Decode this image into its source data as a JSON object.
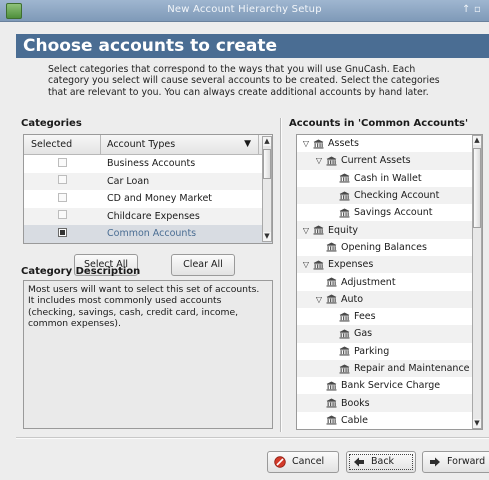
{
  "window": {
    "title": "New Account Hierarchy Setup"
  },
  "header": {
    "title": "Choose accounts to create"
  },
  "intro": {
    "text": "Select categories that correspond to the ways that you will use GnuCash. Each category you select will cause several accounts to be created. Select the categories that are relevant to you. You can always create additional accounts by hand later."
  },
  "categories": {
    "label": "Categories",
    "col_selected": "Selected",
    "col_type": "Account Types",
    "rows": [
      {
        "name": "Business Accounts",
        "checked": false
      },
      {
        "name": "Car Loan",
        "checked": false
      },
      {
        "name": "CD and Money Market",
        "checked": false
      },
      {
        "name": "Childcare Expenses",
        "checked": false
      },
      {
        "name": "Common Accounts",
        "checked": true
      }
    ],
    "select_all": "Select All",
    "clear_all": "Clear All"
  },
  "description": {
    "label": "Category Description",
    "text": "Most users will want to select this set of accounts. It includes most commonly used accounts (checking, savings, cash, credit card, income, common expenses)."
  },
  "accounts": {
    "label": "Accounts in 'Common Accounts'",
    "rows": [
      {
        "name": "Assets",
        "level": 0,
        "expander": "expanded"
      },
      {
        "name": "Current Assets",
        "level": 1,
        "expander": "expanded"
      },
      {
        "name": "Cash in Wallet",
        "level": 2,
        "expander": "none"
      },
      {
        "name": "Checking Account",
        "level": 2,
        "expander": "none"
      },
      {
        "name": "Savings Account",
        "level": 2,
        "expander": "none"
      },
      {
        "name": "Equity",
        "level": 0,
        "expander": "expanded"
      },
      {
        "name": "Opening Balances",
        "level": 1,
        "expander": "none"
      },
      {
        "name": "Expenses",
        "level": 0,
        "expander": "expanded"
      },
      {
        "name": "Adjustment",
        "level": 1,
        "expander": "none"
      },
      {
        "name": "Auto",
        "level": 1,
        "expander": "expanded"
      },
      {
        "name": "Fees",
        "level": 2,
        "expander": "none"
      },
      {
        "name": "Gas",
        "level": 2,
        "expander": "none"
      },
      {
        "name": "Parking",
        "level": 2,
        "expander": "none"
      },
      {
        "name": "Repair and Maintenance",
        "level": 2,
        "expander": "none"
      },
      {
        "name": "Bank Service Charge",
        "level": 1,
        "expander": "none"
      },
      {
        "name": "Books",
        "level": 1,
        "expander": "none"
      },
      {
        "name": "Cable",
        "level": 1,
        "expander": "none"
      }
    ]
  },
  "footer": {
    "cancel": "Cancel",
    "back": "Back",
    "forward": "Forward"
  },
  "colors": {
    "header_bg": "#4a6d93",
    "titlebar": "#8fa7c4",
    "cancel_icon": "#d23a2a"
  },
  "icons": {
    "account": "bank-icon",
    "cancel": "cancel-icon",
    "back": "back-arrow-icon",
    "forward": "forward-arrow-icon"
  }
}
